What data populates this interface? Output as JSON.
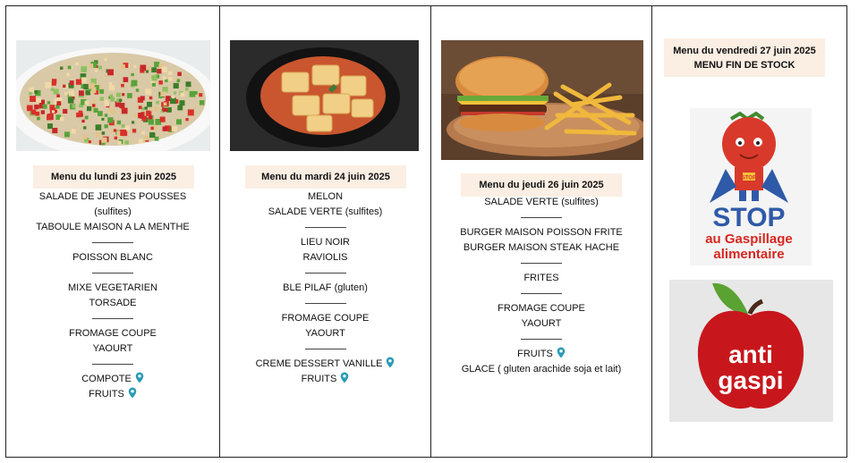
{
  "monday": {
    "title": "Menu du lundi 23 juin 2025",
    "lines": [
      "SALADE DE JEUNES POUSSES",
      "(sulfites)",
      "TABOULE MAISON A LA MENTHE",
      "POISSON BLANC",
      "MIXE VEGETARIEN",
      "TORSADE",
      "FROMAGE COUPE",
      "YAOURT",
      "COMPOTE",
      "FRUITS"
    ]
  },
  "tuesday": {
    "title": "Menu du mardi 24 juin 2025",
    "lines": [
      "MELON",
      "SALADE VERTE (sulfites)",
      "LIEU NOIR",
      "RAVIOLIS",
      "BLE PILAF (gluten)",
      "FROMAGE COUPE",
      "YAOURT",
      "CREME DESSERT VANILLE",
      "FRUITS"
    ]
  },
  "thursday": {
    "title": "Menu du jeudi 26 juin 2025",
    "lines": [
      "SALADE VERTE (sulfites)",
      "BURGER MAISON POISSON FRITE",
      "BURGER MAISON STEAK HACHE",
      "FRITES",
      "FROMAGE COUPE",
      "YAOURT",
      "FRUITS",
      "GLACE ( gluten arachide soja et lait)"
    ]
  },
  "friday": {
    "title": "Menu du vendredi 27 juin 2025",
    "subtitle": "MENU FIN DE STOCK",
    "logo1": {
      "line1": "STOP",
      "line2": "au Gaspillage",
      "line3": "alimentaire",
      "badge": "STOP"
    },
    "logo2": {
      "line1": "anti",
      "line2": "gaspi"
    }
  },
  "icons": {
    "pin": "map-pin-icon"
  },
  "colors": {
    "header_bg": "#fbeee3",
    "pin": "#2a9bb6",
    "stop_blue": "#2f5aa8",
    "stop_red": "#d6271f",
    "apple_red": "#c8171c"
  }
}
